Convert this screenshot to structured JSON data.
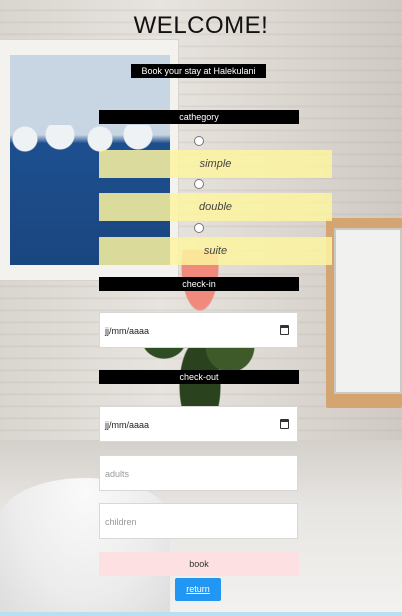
{
  "header": {
    "title": "WELCOME!",
    "subtitle": "Book your stay at Halekulani"
  },
  "category": {
    "label": "cathegory",
    "options": [
      {
        "label": "simple",
        "selected": false
      },
      {
        "label": "double",
        "selected": false
      },
      {
        "label": "suite",
        "selected": false
      }
    ]
  },
  "checkin": {
    "label": "check-in",
    "value": "jj/mm/aaaa"
  },
  "checkout": {
    "label": "check-out",
    "value": "jj/mm/aaaa"
  },
  "guests": {
    "adults_placeholder": "adults",
    "children_placeholder": "children"
  },
  "actions": {
    "book_label": "book",
    "return_label": "return"
  },
  "colors": {
    "option_bg": "#fdf4a0",
    "label_bg": "#000000",
    "book_bg": "#fde0e1",
    "return_bg": "#2196f3"
  },
  "icons": {
    "date_picker": "calendar-icon"
  }
}
